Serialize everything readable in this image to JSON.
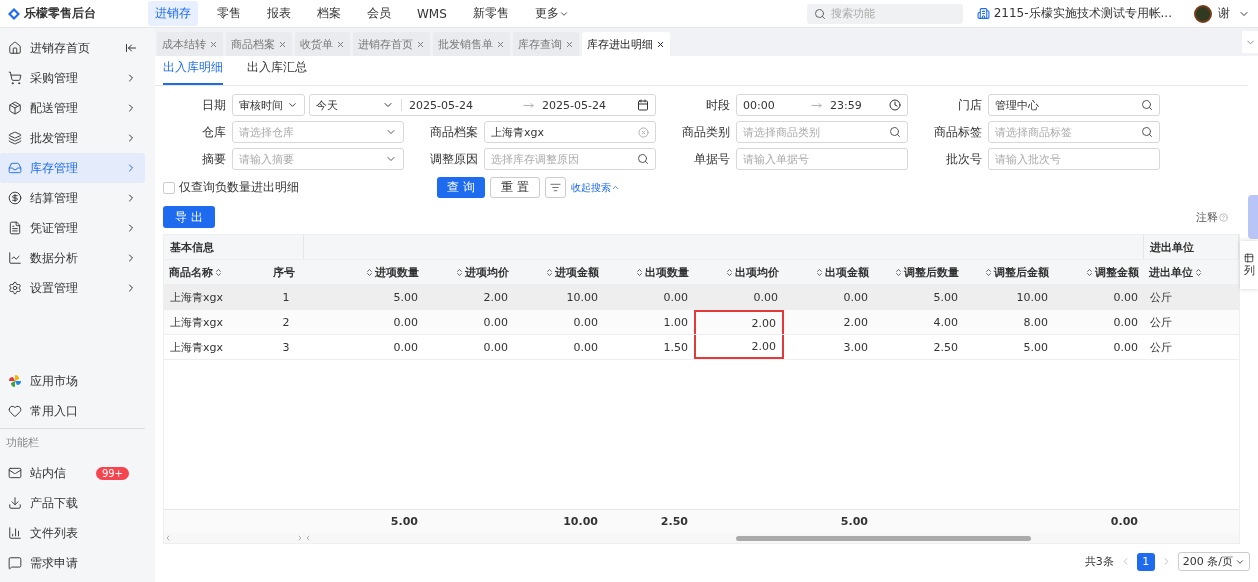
{
  "brand": "乐檬零售后台",
  "top_nav": [
    {
      "label": "进销存",
      "selected": true
    },
    {
      "label": "零售",
      "selected": false
    },
    {
      "label": "报表",
      "selected": false
    },
    {
      "label": "档案",
      "selected": false
    },
    {
      "label": "会员",
      "selected": false
    },
    {
      "label": "WMS",
      "selected": false
    },
    {
      "label": "新零售",
      "selected": false
    },
    {
      "label": "更多",
      "selected": false,
      "dropdown": true
    }
  ],
  "search": {
    "placeholder": "搜索功能"
  },
  "account": "2115-乐檬实施技术测试专用帐...",
  "user": "谢",
  "sidebar": {
    "items": [
      {
        "label": "进销存首页",
        "selected": false,
        "collapse": true
      },
      {
        "label": "采购管理",
        "selected": false
      },
      {
        "label": "配送管理",
        "selected": false
      },
      {
        "label": "批发管理",
        "selected": false
      },
      {
        "label": "库存管理",
        "selected": true
      },
      {
        "label": "结算管理",
        "selected": false
      },
      {
        "label": "凭证管理",
        "selected": false
      },
      {
        "label": "数据分析",
        "selected": false
      },
      {
        "label": "设置管理",
        "selected": false
      }
    ],
    "shortcuts": [
      {
        "label": "应用市场"
      },
      {
        "label": "常用入口"
      }
    ],
    "section": "功能栏",
    "tools": [
      {
        "label": "站内信",
        "badge": "99+"
      },
      {
        "label": "产品下载"
      },
      {
        "label": "文件列表"
      },
      {
        "label": "需求申请"
      }
    ]
  },
  "page_tabs": [
    {
      "label": "成本结转",
      "selected": false
    },
    {
      "label": "商品档案",
      "selected": false
    },
    {
      "label": "收货单",
      "selected": false
    },
    {
      "label": "进销存首页",
      "selected": false
    },
    {
      "label": "批发销售单",
      "selected": false
    },
    {
      "label": "库存查询",
      "selected": false
    },
    {
      "label": "库存进出明细",
      "selected": true
    }
  ],
  "sub_tabs": [
    {
      "label": "出入库明细",
      "selected": true
    },
    {
      "label": "出入库汇总",
      "selected": false
    }
  ],
  "filters": {
    "date_label": "日期",
    "date_type": "审核时间",
    "date_range": "今天",
    "date_from": "2025-05-24",
    "date_to": "2025-05-24",
    "time_label": "时段",
    "time_from": "00:00",
    "time_to": "23:59",
    "fields": [
      {
        "label": "门店",
        "value": "管理中心",
        "kind": "search"
      },
      {
        "label": "仓库",
        "placeholder": "请选择仓库",
        "kind": "select"
      },
      {
        "label": "商品档案",
        "value": "上海青xgx",
        "kind": "clearable"
      },
      {
        "label": "商品类别",
        "placeholder": "请选择商品类别",
        "kind": "search"
      },
      {
        "label": "商品标签",
        "placeholder": "请选择商品标签",
        "kind": "search"
      },
      {
        "label": "摘要",
        "placeholder": "请输入摘要",
        "kind": "select"
      },
      {
        "label": "调整原因",
        "placeholder": "选择库存调整原因",
        "kind": "search"
      },
      {
        "label": "单据号",
        "placeholder": "请输入单据号",
        "kind": "text"
      },
      {
        "label": "批次号",
        "placeholder": "请输入批次号",
        "kind": "text"
      }
    ],
    "negative_only": {
      "label": "仅查询负数量进出明细",
      "checked": false
    },
    "query": "查 询",
    "reset": "重 置",
    "collapse": "收起搜索"
  },
  "export": "导 出",
  "note": "注释",
  "columns_button": "列",
  "table": {
    "groups": [
      "基本信息",
      "进出单位"
    ],
    "columns": [
      {
        "label": "商品名称",
        "sortable": true
      },
      {
        "label": "序号",
        "sortable": false
      },
      {
        "label": "进项数量",
        "sortable": true,
        "total": "5.00"
      },
      {
        "label": "进项均价",
        "sortable": true
      },
      {
        "label": "进项金额",
        "sortable": true,
        "total": "10.00"
      },
      {
        "label": "出项数量",
        "sortable": true,
        "total": "2.50"
      },
      {
        "label": "出项均价",
        "sortable": true
      },
      {
        "label": "出项金额",
        "sortable": true,
        "total": "5.00"
      },
      {
        "label": "调整后数量",
        "sortable": true
      },
      {
        "label": "调整后金额",
        "sortable": true
      },
      {
        "label": "调整金额",
        "sortable": true,
        "total": "0.00"
      },
      {
        "label": "进出单位",
        "sortable": true
      }
    ],
    "rows": [
      {
        "selected": true,
        "boxed": false,
        "cells": [
          "上海青xgx",
          "1",
          "5.00",
          "2.00",
          "10.00",
          "0.00",
          "0.00",
          "0.00",
          "5.00",
          "10.00",
          "0.00",
          "公斤"
        ]
      },
      {
        "selected": false,
        "boxed": true,
        "cells": [
          "上海青xgx",
          "2",
          "0.00",
          "0.00",
          "0.00",
          "1.00",
          "2.00",
          "2.00",
          "4.00",
          "8.00",
          "0.00",
          "公斤"
        ]
      },
      {
        "selected": false,
        "boxed": true,
        "cells": [
          "上海青xgx",
          "3",
          "0.00",
          "0.00",
          "0.00",
          "1.50",
          "2.00",
          "3.00",
          "2.50",
          "5.00",
          "0.00",
          "公斤"
        ]
      }
    ]
  },
  "pagination": {
    "total": "共3条",
    "pages": [
      {
        "label": "1",
        "selected": true
      }
    ],
    "page_size": "200 条/页"
  }
}
